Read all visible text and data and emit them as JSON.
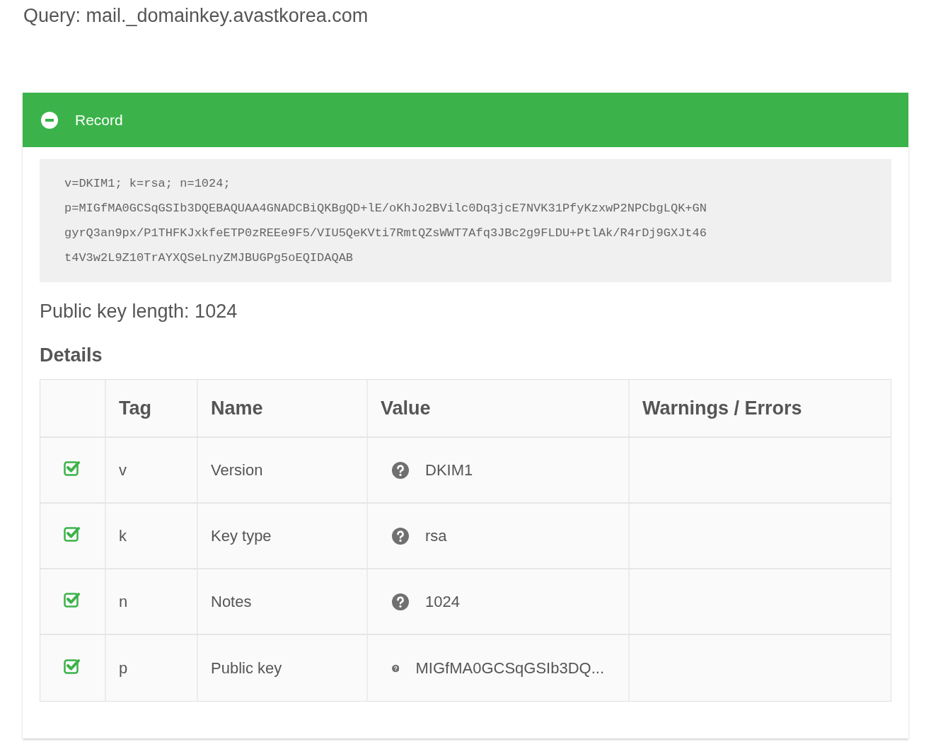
{
  "query": "Query: mail._domainkey.avastkorea.com",
  "record": {
    "title": "Record",
    "expanded": true,
    "lines": [
      "v=DKIM1; k=rsa; n=1024;",
      "p=MIGfMA0GCSqGSIb3DQEBAQUAA4GNADCBiQKBgQD+lE/oKhJo2BVilc0Dq3jcE7NVK31PfyKzxwP2NPCbgLQK+GN",
      "gyrQ3an9px/P1THFKJxkfeETP0zREEe9F5/VIU5QeKVti7RmtQZsWWT7Afq3JBc2g9FLDU+PtlAk/R4rDj9GXJt46",
      "t4V3w2L9Z10TrAYXQSeLnyZMJBUGPg5oEQIDAQAB"
    ],
    "key_length": "Public key length: 1024",
    "details_heading": "Details",
    "table": {
      "columns": [
        "",
        "Tag",
        "Name",
        "Value",
        "Warnings / Errors"
      ],
      "rows": [
        {
          "checked": true,
          "tag": "v",
          "name": "Version",
          "value": "DKIM1"
        },
        {
          "checked": true,
          "tag": "k",
          "name": "Key type",
          "value": "rsa"
        },
        {
          "checked": true,
          "tag": "n",
          "name": "Notes",
          "value": "1024"
        },
        {
          "checked": true,
          "tag": "p",
          "name": "Public key",
          "value": "MIGfMA0GCSqGSIb3DQ..."
        }
      ]
    }
  }
}
